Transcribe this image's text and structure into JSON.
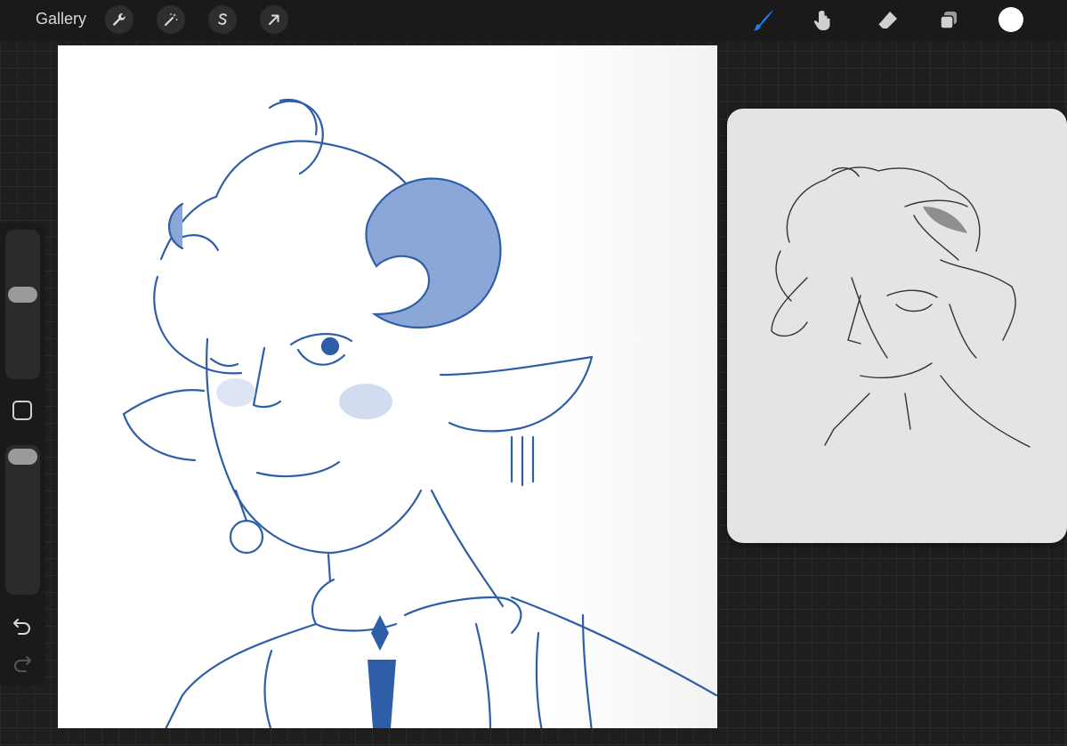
{
  "topbar": {
    "gallery_label": "Gallery",
    "left_tools": [
      "wrench-icon",
      "magic-wand-icon",
      "selection-s-icon",
      "transform-arrow-icon"
    ],
    "right_tools": [
      "brush-icon",
      "smudge-icon",
      "eraser-icon",
      "layers-icon"
    ],
    "active_tool": "brush-icon",
    "active_color": "#ffffff",
    "accent_color": "#1e7ef7"
  },
  "sidebar": {
    "size_slider_level": 0.45,
    "opacity_slider_level": 0.95,
    "icons": [
      "modify-square-icon",
      "undo-icon",
      "redo-icon"
    ]
  },
  "canvas": {
    "line_color": "#2f5ea8",
    "background": "#ffffff"
  },
  "reference": {
    "background": "#e4e4e4",
    "line_color": "#333333"
  }
}
